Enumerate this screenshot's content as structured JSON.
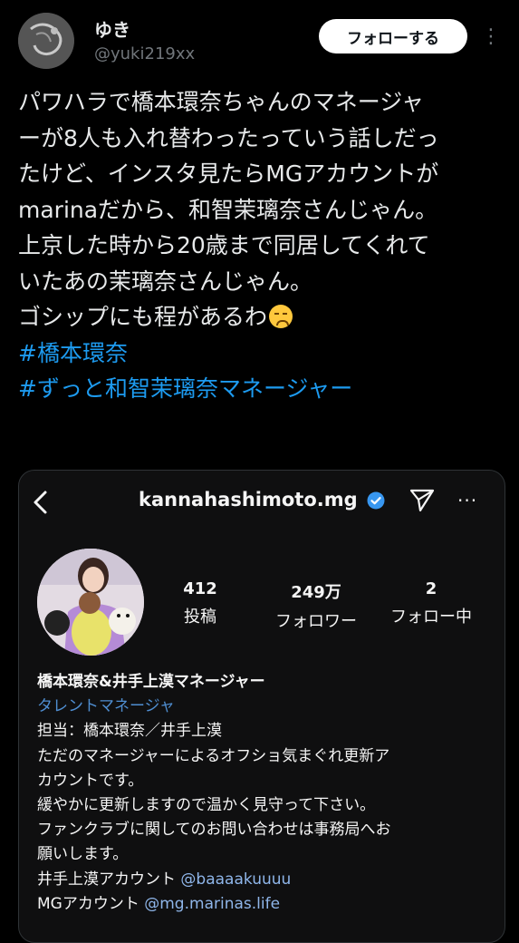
{
  "user": {
    "name": "ゆき",
    "handle": "@yuki219xx",
    "follow_label": "フォローする",
    "more_label": "⋮"
  },
  "tweet": {
    "lines": [
      "パワハラで橋本環奈ちゃんのマネージャ",
      "ーが8人も入れ替わったっていう話しだっ",
      "たけど、インスタ見たらMGアカウントが",
      "marinaだから、和智茉璃奈さんじゃん。",
      "上京した時から20歳まで同居してくれて",
      "いたあの茉璃奈さんじゃん。",
      "ゴシップにも程があるわ"
    ],
    "emoji": "persevering-face",
    "hashtags": [
      "#橋本環奈",
      "#ずっと和智茉璃奈マネージャー"
    ]
  },
  "instagram": {
    "username": "kannahashimoto.mg",
    "more_label": "···",
    "stats": [
      {
        "value": "412",
        "label": "投稿"
      },
      {
        "value": "249万",
        "label": "フォロワー"
      },
      {
        "value": "2",
        "label": "フォロー中"
      }
    ],
    "bio": {
      "name": "橋本環奈&井手上漠マネージャー",
      "category": "タレントマネージャ",
      "lines": [
        "担当：橋本環奈／井手上漠",
        "ただのマネージャーによるオフショ気まぐれ更新ア",
        "カウントです。",
        "緩やかに更新しますので温かく見守って下さい。",
        "ファンクラブに関してのお問い合わせは事務局へお",
        "願いします。"
      ],
      "account1_prefix": "井手上漠アカウント ",
      "account1_handle": "@baaaakuuuu",
      "account2_prefix": "MGアカウント ",
      "account2_handle": "@mg.marinas.life"
    }
  },
  "colors": {
    "background": "#000000",
    "hashtag": "#1d9bf0",
    "verified": "#3897f0",
    "ig_category": "#4f8ed1",
    "ig_mention": "#8fb6ea"
  }
}
